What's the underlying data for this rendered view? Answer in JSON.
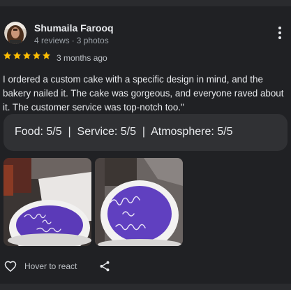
{
  "reviewer": {
    "name": "Shumaila Farooq",
    "reviews": "4 reviews",
    "separator": "·",
    "photos": "3 photos",
    "avatar_icon": "avatar-photo-icon"
  },
  "rating": {
    "stars": 5,
    "max_stars": 5,
    "star_color": "#fbbc04",
    "time_ago": "3 months ago"
  },
  "review": {
    "text": "I ordered a custom cake with a specific design in mind, and the bakery nailed it. The cake was gorgeous, and everyone raved about it. The customer service was top-notch too.\""
  },
  "ratings_summary": {
    "text": "Food: 5/5  |  Service: 5/5  |  Atmosphere: 5/5"
  },
  "photos": [
    {
      "icon": "cake-photo-icon",
      "cake_text": [
        "Farooq",
        "Ke",
        "Duniya"
      ],
      "frosting_color": "#5b3ab8"
    },
    {
      "icon": "cake-photo-icon",
      "cake_text": [
        "Farooq",
        "Ke",
        "Duniya"
      ],
      "frosting_color": "#6040c0"
    }
  ],
  "actions": {
    "react_label": "Hover to react",
    "heart_icon": "heart-outline-icon",
    "share_icon": "share-icon",
    "more_icon": "more-vertical-icon"
  },
  "colors": {
    "background": "#202124",
    "card": "#303134",
    "text_primary": "#e8eaed",
    "text_secondary": "#9aa0a6"
  }
}
